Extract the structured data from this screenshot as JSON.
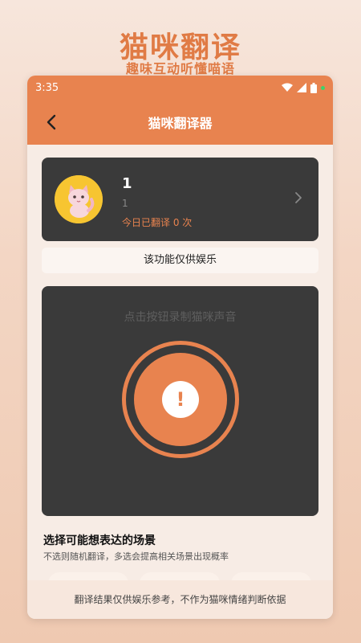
{
  "promo": {
    "title": "猫咪翻译",
    "subtitle": "趣味互动听懂喵语"
  },
  "status_bar": {
    "time": "3:35",
    "icons": [
      "wifi-icon",
      "signal-icon",
      "battery-icon"
    ]
  },
  "app_bar": {
    "title": "猫咪翻译器",
    "back_icon": "chevron-left-icon"
  },
  "profile": {
    "name": "1",
    "subtitle": "1",
    "count_text": "今日已翻译 0 次",
    "avatar_icon": "cat-avatar",
    "chevron_icon": "chevron-right-icon"
  },
  "notice": "该功能仅供娱乐",
  "recorder": {
    "hint": "点击按钮录制猫咪声音",
    "button_icon": "exclamation-icon",
    "button_glyph": "!"
  },
  "scenes": {
    "title": "选择可能想表达的场景",
    "subtitle": "不选则随机翻译，多选会提高相关场景出现概率"
  },
  "footer": "翻译结果仅供娱乐参考，不作为猫咪情绪判断依据",
  "colors": {
    "accent": "#e8834f",
    "card_dark": "#3a3a3a",
    "avatar_bg": "#f7c531"
  }
}
